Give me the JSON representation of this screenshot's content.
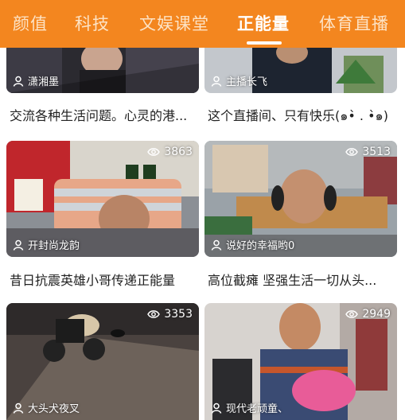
{
  "tabs": [
    {
      "label": "颜值"
    },
    {
      "label": "科技"
    },
    {
      "label": "文娱课堂"
    },
    {
      "label": "正能量"
    },
    {
      "label": "体育直播"
    }
  ],
  "active_tab": "正能量",
  "colors": {
    "brand": "#f3861f",
    "tab_inactive": "#fde3c5",
    "text": "#222222"
  },
  "icons": {
    "viewer": "eye-icon",
    "anchor": "person-icon"
  },
  "rooms": [
    {
      "anchor": "潇湘墨",
      "title": "交流各种生活问题。心灵的港..."
    },
    {
      "anchor": "主播长飞",
      "title": "这个直播间、只有快乐(๑•̀ . •̀๑)"
    },
    {
      "viewers": "3863",
      "anchor": "开封尚龙韵",
      "title": "昔日抗震英雄小哥传递正能量"
    },
    {
      "viewers": "3513",
      "anchor": "说好的幸福哟0",
      "title": "高位截瘫 坚强生活一切从头..."
    },
    {
      "viewers": "3353",
      "anchor": "大头犬夜叉"
    },
    {
      "viewers": "2949",
      "anchor": "现代老顽童、"
    }
  ]
}
